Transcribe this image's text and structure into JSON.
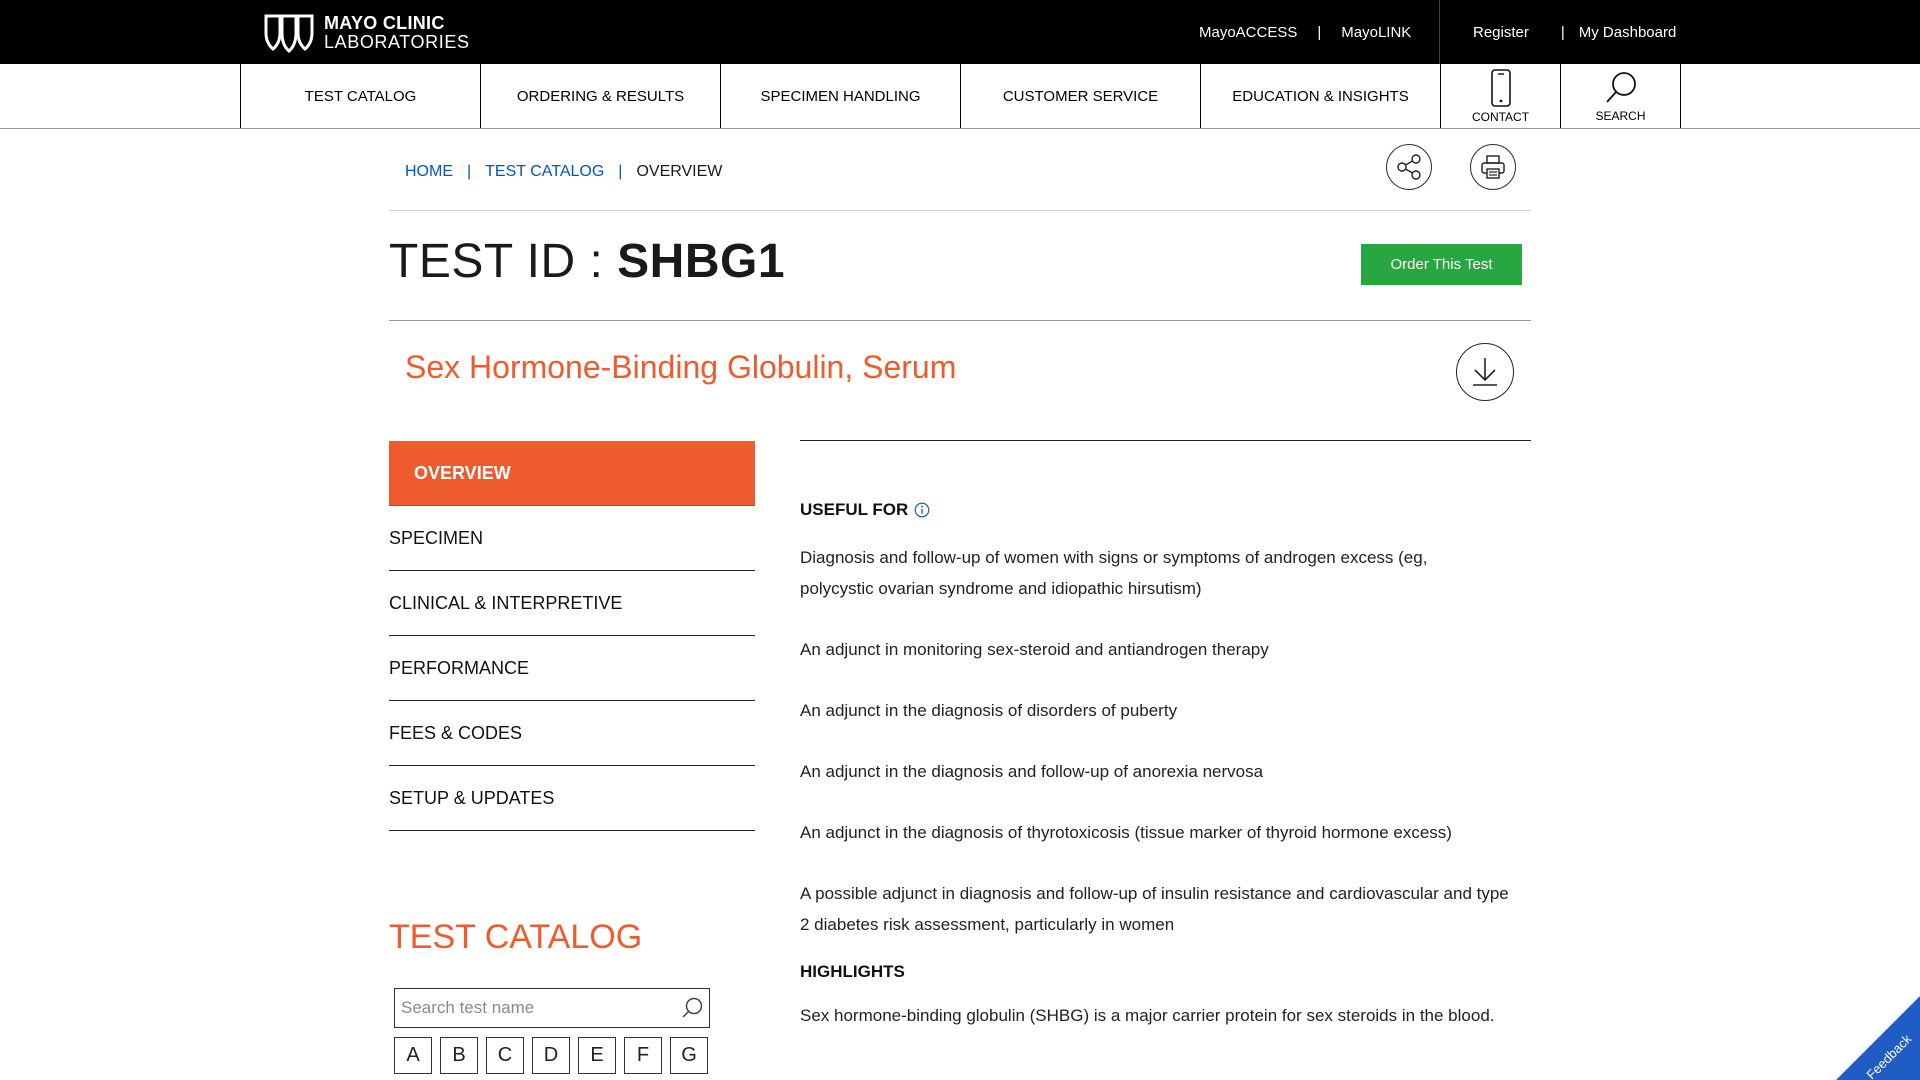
{
  "brand": {
    "line1": "MAYO CLINIC",
    "line2": "LABORATORIES"
  },
  "top_links": {
    "mayoaccess": "MayoACCESS",
    "mayolink": "MayoLINK",
    "register": "Register",
    "dashboard": "My Dashboard",
    "separator": "|"
  },
  "nav": {
    "items": [
      "TEST CATALOG",
      "ORDERING & RESULTS",
      "SPECIMEN HANDLING",
      "CUSTOMER SERVICE",
      "EDUCATION & INSIGHTS"
    ],
    "contact": "CONTACT",
    "search": "SEARCH"
  },
  "breadcrumb": {
    "home": "HOME",
    "catalog": "TEST CATALOG",
    "current": "OVERVIEW",
    "separator": "|"
  },
  "test": {
    "id_label": "TEST ID :",
    "id_value": "SHBG1",
    "name": "Sex Hormone-Binding Globulin, Serum",
    "order_label": "Order This Test"
  },
  "side_menu": [
    "OVERVIEW",
    "SPECIMEN",
    "CLINICAL & INTERPRETIVE",
    "PERFORMANCE",
    "FEES & CODES",
    "SETUP & UPDATES"
  ],
  "catalog": {
    "title": "TEST CATALOG",
    "search_placeholder": "Search test name",
    "letters": [
      "A",
      "B",
      "C",
      "D",
      "E",
      "F",
      "G"
    ]
  },
  "useful_for": {
    "heading": "USEFUL FOR",
    "items": [
      "Diagnosis and follow-up of women with signs or symptoms of androgen excess (eg, polycystic ovarian syndrome and idiopathic hirsutism)",
      "An adjunct in monitoring sex-steroid and antiandrogen therapy",
      "An adjunct in the diagnosis of disorders of puberty",
      "An adjunct in the diagnosis and follow-up of anorexia nervosa",
      "An adjunct in the diagnosis of thyrotoxicosis (tissue marker of thyroid hormone excess)",
      "A possible adjunct in diagnosis and follow-up of insulin resistance and cardiovascular and type 2 diabetes risk assessment, particularly in women"
    ]
  },
  "highlights": {
    "heading": "HIGHLIGHTS",
    "text": "Sex hormone-binding globulin (SHBG) is a major carrier protein for sex steroids in the blood."
  },
  "feedback": "Feedback",
  "colors": {
    "accent": "#ee5b2e",
    "link": "#0057b8",
    "order_button": "#27a641",
    "feedback": "#1f5cc4"
  }
}
